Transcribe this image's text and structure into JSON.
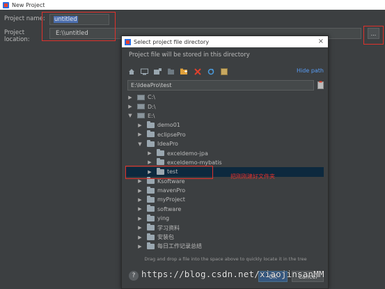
{
  "window": {
    "title": "New Project"
  },
  "form": {
    "name_label": "Project name:",
    "name_value": "untitled",
    "location_label": "Project location:",
    "location_value": "E:\\\\untitled",
    "browse_label": "..."
  },
  "dialog": {
    "title": "Select project file directory",
    "close_glyph": "×",
    "description": "Project file will be stored in this directory",
    "hide_path_label": "Hide path",
    "path_value": "E:\\IdeaPro\\test",
    "annotation": "把刚刚建好文件夹",
    "drag_hint": "Drag and drop a file into the space above to quickly locate it in the tree",
    "help_label": "?",
    "ok_label": "OK",
    "cancel_label": "Cancel",
    "toolbar_icons": [
      "home-icon",
      "desktop-icon",
      "project-icon",
      "module-icon",
      "new-folder-icon",
      "delete-icon",
      "refresh-icon",
      "show-hidden-icon"
    ],
    "tree": [
      {
        "label": "C:\\",
        "depth": 0,
        "expanded": false,
        "kind": "drive"
      },
      {
        "label": "D:\\",
        "depth": 0,
        "expanded": false,
        "kind": "drive"
      },
      {
        "label": "E:\\",
        "depth": 0,
        "expanded": true,
        "kind": "drive"
      },
      {
        "label": "demo01",
        "depth": 1,
        "expanded": false,
        "kind": "folder"
      },
      {
        "label": "eclipsePro",
        "depth": 1,
        "expanded": false,
        "kind": "folder"
      },
      {
        "label": "IdeaPro",
        "depth": 1,
        "expanded": true,
        "kind": "folder"
      },
      {
        "label": "exceldemo-jpa",
        "depth": 2,
        "expanded": false,
        "kind": "folder"
      },
      {
        "label": "exceldemo-mybatis",
        "depth": 2,
        "expanded": false,
        "kind": "folder"
      },
      {
        "label": "test",
        "depth": 2,
        "expanded": false,
        "kind": "folder",
        "selected": true
      },
      {
        "label": "Ksoftware",
        "depth": 1,
        "expanded": false,
        "kind": "folder"
      },
      {
        "label": "mavenPro",
        "depth": 1,
        "expanded": false,
        "kind": "folder"
      },
      {
        "label": "myProject",
        "depth": 1,
        "expanded": false,
        "kind": "folder"
      },
      {
        "label": "software",
        "depth": 1,
        "expanded": false,
        "kind": "folder"
      },
      {
        "label": "ying",
        "depth": 1,
        "expanded": false,
        "kind": "folder"
      },
      {
        "label": "学习资料",
        "depth": 1,
        "expanded": false,
        "kind": "folder"
      },
      {
        "label": "安装包",
        "depth": 1,
        "expanded": false,
        "kind": "folder"
      },
      {
        "label": "每日工作记录总结",
        "depth": 1,
        "expanded": false,
        "kind": "folder"
      }
    ]
  },
  "watermark": "https://blog.csdn.net/xiaojinsanMM",
  "colors": {
    "background": "#3c3f41",
    "selection": "#0d293e",
    "highlight_red": "#e0312c",
    "link_blue": "#589df6"
  }
}
